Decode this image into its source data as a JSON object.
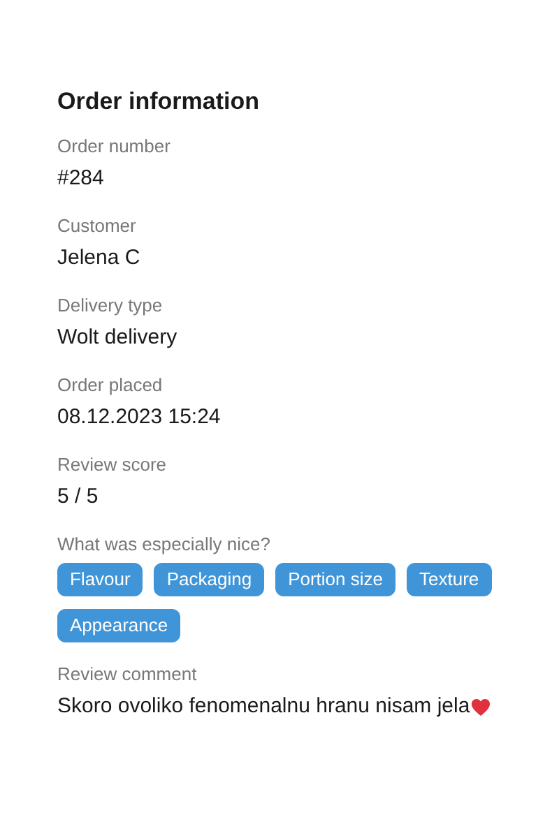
{
  "title": "Order information",
  "fields": [
    {
      "label": "Order number",
      "value": "#284"
    },
    {
      "label": "Customer",
      "value": "Jelena C"
    },
    {
      "label": "Delivery type",
      "value": "Wolt delivery"
    },
    {
      "label": "Order placed",
      "value": "08.12.2023 15:24"
    },
    {
      "label": "Review score",
      "value": "5 / 5"
    }
  ],
  "highlights": {
    "label": "What was especially nice?",
    "tags": [
      "Flavour",
      "Packaging",
      "Portion size",
      "Texture",
      "Appearance"
    ]
  },
  "comment": {
    "label": "Review comment",
    "text": "Skoro ovoliko fenomenalnu hranu nisam jela"
  }
}
